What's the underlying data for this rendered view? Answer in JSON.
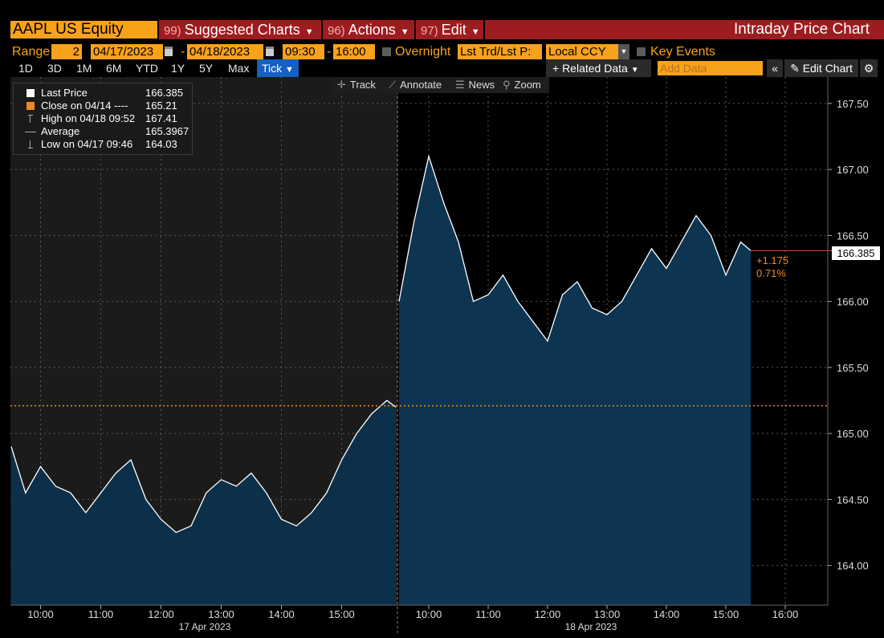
{
  "header": {
    "ticker": "AAPL US Equity",
    "suggested": {
      "num": "99)",
      "label": "Suggested Charts"
    },
    "actions": {
      "num": "96)",
      "label": "Actions"
    },
    "edit": {
      "num": "97)",
      "label": "Edit"
    },
    "title": "Intraday Price Chart"
  },
  "range": {
    "label": "Range",
    "number": "2",
    "start_date": "04/17/2023",
    "end_date": "04/18/2023",
    "start_time": "09:30",
    "end_time": "16:00",
    "overnight": "Overnight",
    "field": "Lst Trd/Lst P:",
    "currency": "Local CCY",
    "key_events": "Key Events"
  },
  "periods": [
    "1D",
    "3D",
    "1M",
    "6M",
    "YTD",
    "1Y",
    "5Y",
    "Max"
  ],
  "selected_period": "Tick",
  "controls": {
    "related_data": "+ Related Data",
    "add_data_placeholder": "Add Data",
    "collapse": "«",
    "edit_chart": "Edit Chart",
    "settings": "⚙"
  },
  "toolbar": {
    "track": "Track",
    "annotate": "Annotate",
    "news": "News",
    "zoom": "Zoom"
  },
  "legend": [
    {
      "label": "Last Price",
      "value": "166.385",
      "icon": "white-square"
    },
    {
      "label": "Close on 04/14 ----",
      "value": "165.21",
      "icon": "orange-square"
    },
    {
      "label": "High on 04/18 09:52",
      "value": "167.41",
      "icon": "high-marker"
    },
    {
      "label": "Average",
      "value": "165.3967",
      "icon": "average-marker"
    },
    {
      "label": "Low on 04/17 09:46",
      "value": "164.03",
      "icon": "low-marker"
    }
  ],
  "last_price_label": "166.385",
  "change": {
    "abs": "+1.175",
    "pct": "0.71%"
  },
  "colors": {
    "accent": "#f7a21b",
    "red": "#9d1c1f",
    "area": "#0d3552",
    "line": "#ffffff",
    "close_line": "#f08a1c",
    "selected": "#1560c0"
  },
  "chart_data": {
    "type": "area",
    "y_ticks": [
      164.0,
      164.5,
      165.0,
      165.5,
      166.0,
      166.5,
      167.0,
      167.5
    ],
    "ylim": [
      163.7,
      167.7
    ],
    "x_tick_labels": {
      "day1": [
        "10:00",
        "11:00",
        "12:00",
        "13:00",
        "14:00",
        "15:00"
      ],
      "day2": [
        "10:00",
        "11:00",
        "12:00",
        "13:00",
        "14:00",
        "15:00",
        "16:00"
      ]
    },
    "days": [
      "17 Apr 2023",
      "18 Apr 2023"
    ],
    "reference_line": {
      "label": "Close on 04/14",
      "value": 165.21
    },
    "series": [
      {
        "name": "Last Price",
        "day1": {
          "times": [
            "09:30",
            "09:45",
            "10:00",
            "10:15",
            "10:30",
            "10:45",
            "11:00",
            "11:15",
            "11:30",
            "11:45",
            "12:00",
            "12:15",
            "12:30",
            "12:45",
            "13:00",
            "13:15",
            "13:30",
            "13:45",
            "14:00",
            "14:15",
            "14:30",
            "14:45",
            "15:00",
            "15:15",
            "15:30",
            "15:45",
            "16:00"
          ],
          "values": [
            164.9,
            164.55,
            164.75,
            164.6,
            164.55,
            164.4,
            164.55,
            164.7,
            164.8,
            164.5,
            164.35,
            164.25,
            164.3,
            164.55,
            164.65,
            164.6,
            164.7,
            164.55,
            164.35,
            164.3,
            164.4,
            164.55,
            164.8,
            165.0,
            165.15,
            165.25,
            165.2
          ]
        },
        "day2": {
          "times": [
            "09:30",
            "09:45",
            "10:00",
            "10:15",
            "10:30",
            "10:45",
            "11:00",
            "11:15",
            "11:30",
            "11:45",
            "12:00",
            "12:15",
            "12:30",
            "12:45",
            "13:00",
            "13:15",
            "13:30",
            "13:45",
            "14:00",
            "14:15",
            "14:30",
            "14:45",
            "15:00",
            "15:15",
            "15:30"
          ],
          "values": [
            166.0,
            166.6,
            167.1,
            166.75,
            166.45,
            166.0,
            166.05,
            166.2,
            166.0,
            165.85,
            165.7,
            166.05,
            166.15,
            165.95,
            165.9,
            166.0,
            166.2,
            166.4,
            166.25,
            166.45,
            166.65,
            166.5,
            166.2,
            166.45,
            166.385
          ]
        }
      }
    ]
  }
}
